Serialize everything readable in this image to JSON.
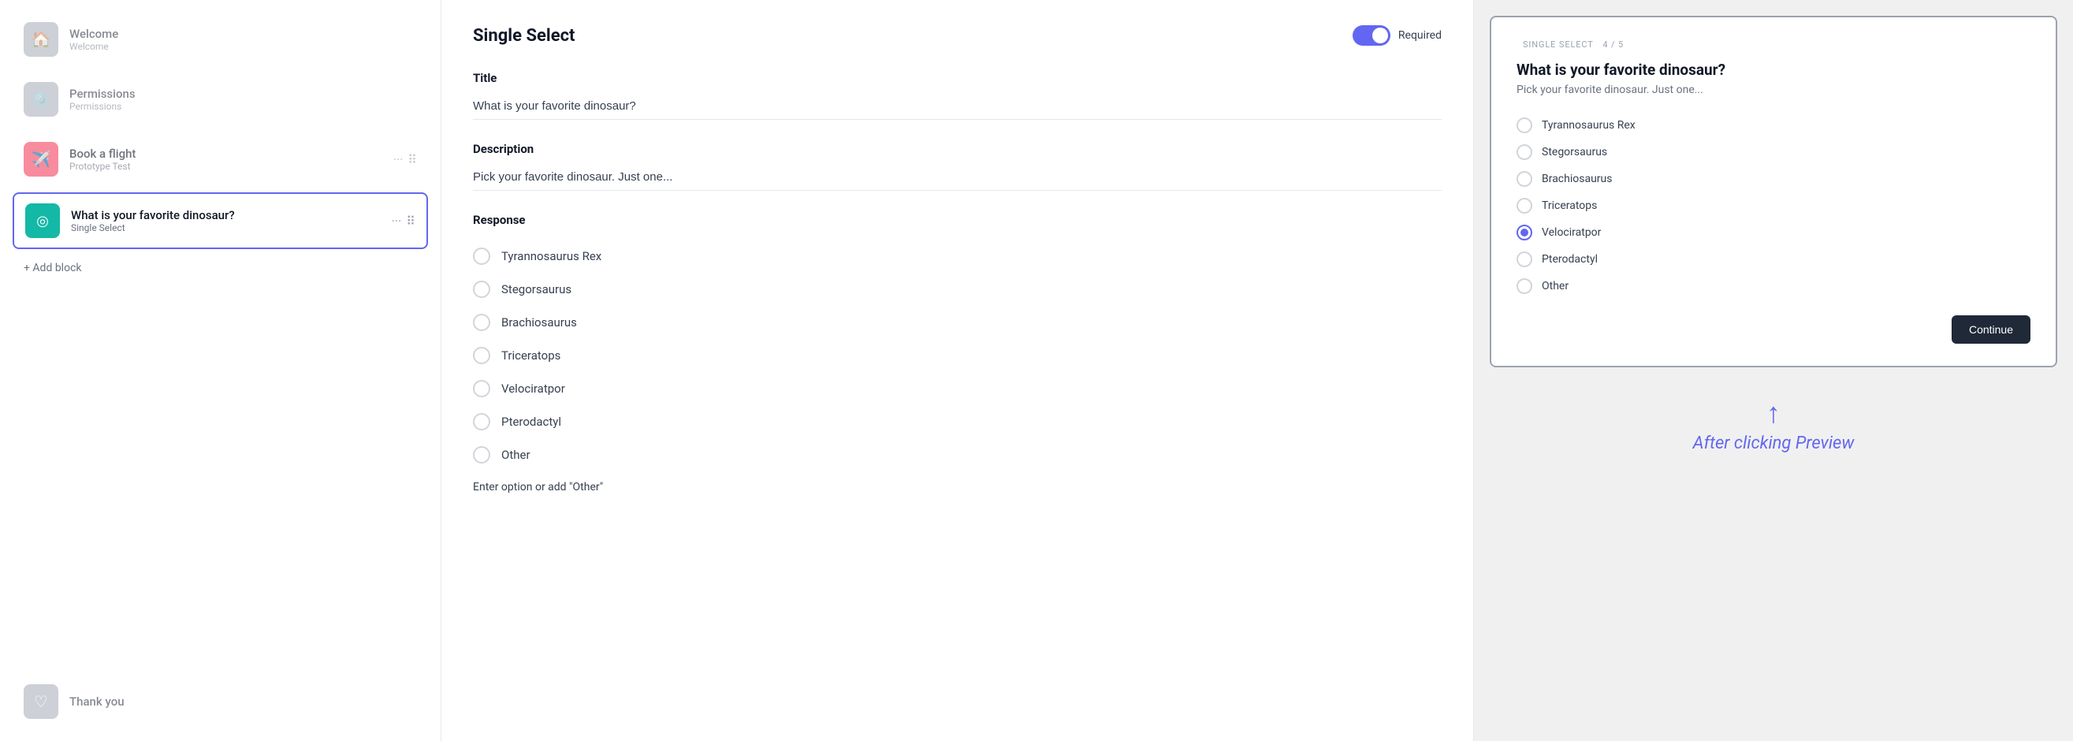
{
  "sidebar": {
    "items": [
      {
        "id": "welcome",
        "title": "Welcome",
        "subtitle": "Welcome",
        "icon": "🏠",
        "iconType": "gray"
      },
      {
        "id": "permissions",
        "title": "Permissions",
        "subtitle": "Permissions",
        "icon": "⚙️",
        "iconType": "gray"
      },
      {
        "id": "book-flight",
        "title": "Book a flight",
        "subtitle": "Prototype Test",
        "icon": "✈️",
        "iconType": "pink",
        "hasActions": true
      },
      {
        "id": "favorite-dino",
        "title": "What is your favorite dinosaur?",
        "subtitle": "Single Select",
        "icon": "◎",
        "iconType": "teal",
        "active": true,
        "hasActions": true
      },
      {
        "id": "thank-you",
        "title": "Thank you",
        "subtitle": "",
        "icon": "♡",
        "iconType": "gray"
      }
    ],
    "add_block_label": "+ Add block"
  },
  "main": {
    "header_title": "Single Select",
    "required_label": "Required",
    "title_section": {
      "label": "Title",
      "value": "What is your favorite dinosaur?"
    },
    "description_section": {
      "label": "Description",
      "value": "Pick your favorite dinosaur. Just one..."
    },
    "response_section": {
      "label": "Response",
      "options": [
        "Tyrannosaurus Rex",
        "Stegorsaurus",
        "Brachiosaurus",
        "Triceratops",
        "Velociratpor",
        "Pterodactyl",
        "Other"
      ],
      "enter_option_text": "Enter option",
      "add_other_text": "or add \"Other\""
    }
  },
  "preview": {
    "meta_label": "SINGLE SELECT",
    "meta_count": "4 / 5",
    "question": "What is your favorite dinosaur?",
    "description": "Pick your favorite dinosaur. Just one...",
    "options": [
      {
        "label": "Tyrannosaurus Rex",
        "selected": false
      },
      {
        "label": "Stegorsaurus",
        "selected": false
      },
      {
        "label": "Brachiosaurus",
        "selected": false
      },
      {
        "label": "Triceratops",
        "selected": false
      },
      {
        "label": "Velociratpor",
        "selected": true
      },
      {
        "label": "Pterodactyl",
        "selected": false
      },
      {
        "label": "Other",
        "selected": false
      }
    ],
    "continue_btn": "Continue",
    "caption_text": "After clicking ",
    "caption_italic": "Preview",
    "arrow": "↑"
  }
}
